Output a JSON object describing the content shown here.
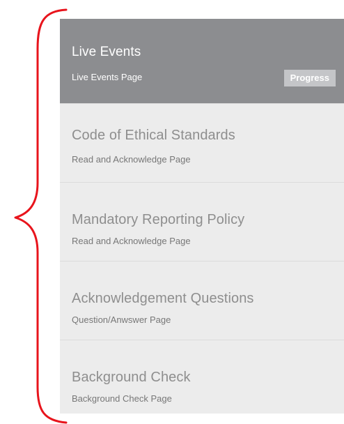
{
  "annotation": {
    "brace_color": "#e8141c"
  },
  "sidebar": {
    "items": [
      {
        "title": "Live Events",
        "subtitle": "Live Events Page",
        "badge": "Progress",
        "active": true
      },
      {
        "title": "Code of Ethical Standards",
        "subtitle": "Read and Acknowledge Page",
        "active": false
      },
      {
        "title": "Mandatory Reporting Policy",
        "subtitle": "Read and Acknowledge Page",
        "active": false
      },
      {
        "title": "Acknowledgement Questions",
        "subtitle": "Question/Anwswer Page",
        "active": false
      },
      {
        "title": "Background Check",
        "subtitle": "Background Check Page",
        "active": false
      }
    ],
    "colors": {
      "active_bg": "#8c8d90",
      "inactive_bg": "#ececec",
      "badge_bg": "#c4c5c8"
    }
  }
}
